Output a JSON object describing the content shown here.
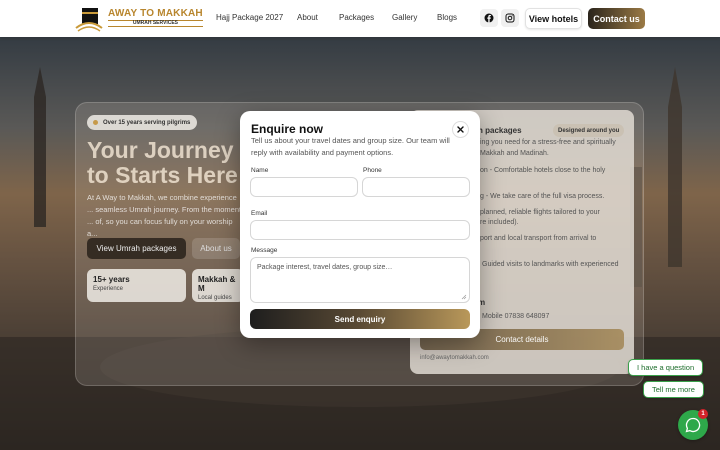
{
  "brand": {
    "title": "AWAY TO MAKKAH",
    "subtitle": "UMRAH SERVICES"
  },
  "nav": {
    "links": [
      "Hajj Package 2027",
      "About",
      "Packages",
      "Gallery",
      "Blogs"
    ],
    "view_hotels": "View hotels",
    "contact_us": "Contact us"
  },
  "hero": {
    "badge": "Over 15 years serving pilgrims",
    "title": "Your Journey to Starts Here",
    "description": "At A Way to Makkah, we combine experience ... seamless Umrah journey. From the moment ... of, so you can focus fully on your worship a...",
    "primary_button": "View Umrah packages",
    "secondary_button": "About us",
    "stats": [
      {
        "value": "15+ years",
        "label": "Experience"
      },
      {
        "value": "Makkah & M",
        "label": "Local guides"
      }
    ]
  },
  "panel": {
    "title": "h packages",
    "tag": "Designed around you",
    "lines": [
      "ing you need for a stress-free and spiritually",
      "Makkah and Madinah.",
      "on - Comfortable hotels close to the holy",
      "g - We take care of the full visa process.",
      "planned, reliable flights tailored to your",
      "re included).",
      "port and local transport from arrival to",
      "Guided visits to landmarks with experienced"
    ],
    "contact_name": "m",
    "phone": "Mobile 07838 648097",
    "details_button": "Contact details",
    "email": "info@awaytomakkah.com"
  },
  "chat": {
    "bubble1": "I have a question",
    "bubble2": "Tell me more",
    "unread": "1"
  },
  "modal": {
    "title": "Enquire now",
    "subtitle": "Tell us about your travel dates and group size. Our team will reply with availability and payment options.",
    "name_label": "Name",
    "phone_label": "Phone",
    "email_label": "Email",
    "message_label": "Message",
    "message_placeholder": "Package interest, travel dates, group size…",
    "submit": "Send enquiry"
  },
  "colors": {
    "accent_gold": "#b8862e",
    "chat_green": "#2ea84a"
  }
}
